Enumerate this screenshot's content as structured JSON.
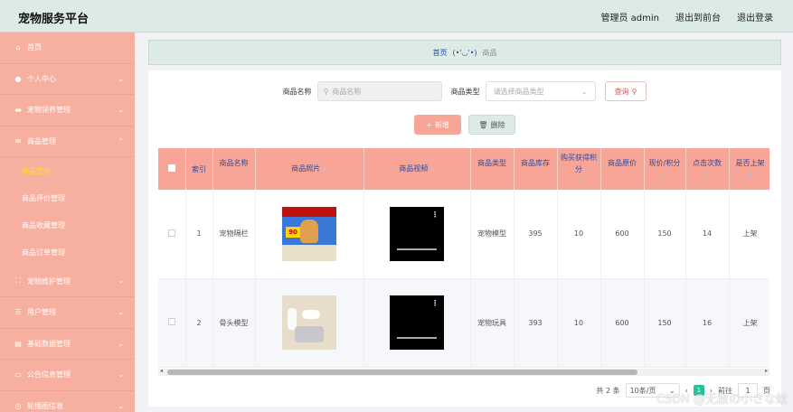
{
  "header": {
    "title": "宠物服务平台",
    "user": "管理员 admin",
    "back": "退出到前台",
    "logout": "退出登录"
  },
  "sidebar": {
    "items": [
      {
        "label": "首页",
        "icon": "home-icon"
      },
      {
        "label": "个人中心",
        "icon": "user-icon"
      },
      {
        "label": "宠物领养管理",
        "icon": "briefcase-icon"
      },
      {
        "label": "商品管理",
        "icon": "mail-icon"
      }
    ],
    "subitems": [
      "商品管理",
      "商品评价管理",
      "商品收藏管理",
      "商品订单管理"
    ],
    "items2": [
      {
        "label": "宠物维护管理",
        "icon": "expand-icon"
      },
      {
        "label": "用户管理",
        "icon": "sliders-icon"
      },
      {
        "label": "基础数据管理",
        "icon": "clipboard-icon"
      },
      {
        "label": "公告信息管理",
        "icon": "ticket-icon"
      },
      {
        "label": "轮播图信息",
        "icon": "clock-icon"
      }
    ]
  },
  "breadcrumb": {
    "home": "首页",
    "face": "(•'◡'•)",
    "current": "商品"
  },
  "search": {
    "name_label": "商品名称",
    "name_placeholder": "商品名称",
    "type_label": "商品类型",
    "type_placeholder": "请选择商品类型",
    "query": "查询"
  },
  "actions": {
    "add": "新增",
    "delete": "删除"
  },
  "table": {
    "headers": [
      "索引",
      "商品名称",
      "商品照片",
      "商品视频",
      "商品类型",
      "商品库存",
      "购买获得积分",
      "商品原价",
      "现价/积分",
      "点击次数",
      "是否上架"
    ],
    "rows": [
      {
        "index": "1",
        "name": "宠物隔栏",
        "type": "宠物模型",
        "stock": "395",
        "points": "10",
        "price": "600",
        "now": "150",
        "clicks": "14",
        "status": "上架",
        "img_badge": "90"
      },
      {
        "index": "2",
        "name": "骨头模型",
        "type": "宠物玩具",
        "stock": "393",
        "points": "10",
        "price": "600",
        "now": "150",
        "clicks": "16",
        "status": "上架"
      }
    ]
  },
  "pagination": {
    "total": "共 2 条",
    "size": "10条/页",
    "current": "1",
    "goto": "前往",
    "page_input": "1",
    "page_suffix": "页"
  },
  "watermark": "CSDN @无敌の小さな蚊"
}
